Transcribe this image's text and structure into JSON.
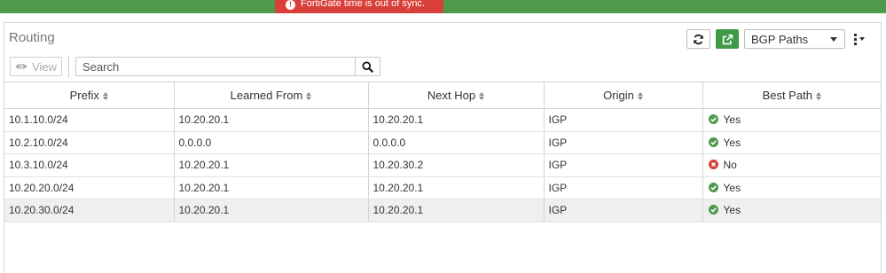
{
  "banner": {
    "message": "FortiGate time is out of sync.",
    "icon": "exclamation-circle-icon",
    "color": "#d9403a",
    "bar_color": "#4f9a4c"
  },
  "panel": {
    "title": "Routing",
    "view_select": {
      "selected": "BGP Paths",
      "options": [
        "BGP Paths"
      ]
    },
    "toolbar_icons": [
      "refresh-icon",
      "export-icon",
      "more-menu-icon"
    ]
  },
  "toolbar": {
    "view_label": "View",
    "search_placeholder": "Search"
  },
  "table": {
    "columns": [
      "Prefix",
      "Learned From",
      "Next Hop",
      "Origin",
      "Best Path"
    ],
    "rows": [
      {
        "prefix": "10.1.10.0/24",
        "learned_from": "10.20.20.1",
        "next_hop": "10.20.20.1",
        "origin": "IGP",
        "best_path": "Yes",
        "best": true
      },
      {
        "prefix": "10.2.10.0/24",
        "learned_from": "0.0.0.0",
        "next_hop": "0.0.0.0",
        "origin": "IGP",
        "best_path": "Yes",
        "best": true
      },
      {
        "prefix": "10.3.10.0/24",
        "learned_from": "10.20.20.1",
        "next_hop": "10.20.30.2",
        "origin": "IGP",
        "best_path": "No",
        "best": false
      },
      {
        "prefix": "10.20.20.0/24",
        "learned_from": "10.20.20.1",
        "next_hop": "10.20.20.1",
        "origin": "IGP",
        "best_path": "Yes",
        "best": true
      },
      {
        "prefix": "10.20.30.0/24",
        "learned_from": "10.20.20.1",
        "next_hop": "10.20.20.1",
        "origin": "IGP",
        "best_path": "Yes",
        "best": true,
        "selected": true
      }
    ]
  },
  "colors": {
    "status_yes": "#4e9a4f",
    "status_no": "#d43f3a",
    "export_button": "#3e9a47"
  }
}
